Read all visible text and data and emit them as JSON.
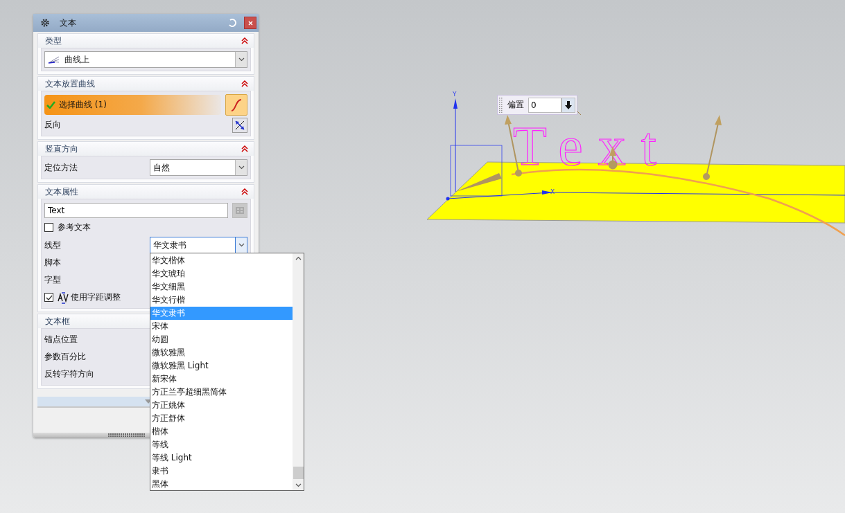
{
  "dialog": {
    "title": "文本",
    "sections": [
      {
        "title": "类型",
        "expanded": true,
        "rows": [
          {
            "kind": "type-select",
            "value": "曲线上"
          }
        ]
      },
      {
        "title": "文本放置曲线",
        "expanded": true,
        "rows": [
          {
            "kind": "selection",
            "label": "选择曲线 (1)",
            "done": true
          },
          {
            "kind": "reverse",
            "label": "反向"
          }
        ]
      },
      {
        "title": "竖直方向",
        "expanded": true,
        "rows": [
          {
            "kind": "select",
            "label": "定位方法",
            "value": "自然",
            "open": false
          }
        ]
      },
      {
        "title": "文本属性",
        "expanded": true,
        "rows": [
          {
            "kind": "text-input",
            "value": "Text"
          },
          {
            "kind": "checkbox",
            "label": "参考文本",
            "checked": false
          },
          {
            "kind": "select",
            "label": "线型",
            "value": "华文隶书",
            "open": true
          },
          {
            "kind": "label",
            "label": "脚本"
          },
          {
            "kind": "label",
            "label": "字型"
          },
          {
            "kind": "kerning-checkbox",
            "label": "使用字距调整",
            "checked": true
          }
        ]
      },
      {
        "title": "文本框",
        "rows": [
          {
            "kind": "label",
            "label": "锚点位置"
          },
          {
            "kind": "label",
            "label": "参数百分比"
          },
          {
            "kind": "label",
            "label": "反转字符方向"
          }
        ]
      }
    ]
  },
  "font_list": {
    "items": [
      {
        "label": "华文楷体",
        "selected": false
      },
      {
        "label": "华文琥珀",
        "selected": false
      },
      {
        "label": "华文细黑",
        "selected": false
      },
      {
        "label": "华文行楷",
        "selected": false
      },
      {
        "label": "华文隶书",
        "selected": true
      },
      {
        "label": "宋体",
        "selected": false
      },
      {
        "label": "幼圆",
        "selected": false
      },
      {
        "label": "微软雅黑",
        "selected": false
      },
      {
        "label": "微软雅黑 Light",
        "selected": false
      },
      {
        "label": "新宋体",
        "selected": false
      },
      {
        "label": "方正兰亭超细黑简体",
        "selected": false
      },
      {
        "label": "方正姚体",
        "selected": false
      },
      {
        "label": "方正舒体",
        "selected": false
      },
      {
        "label": "楷体",
        "selected": false
      },
      {
        "label": "等线",
        "selected": false
      },
      {
        "label": "等线 Light",
        "selected": false
      },
      {
        "label": "隶书",
        "selected": false
      },
      {
        "label": "黑体",
        "selected": false
      }
    ]
  },
  "scene": {
    "text": "Text",
    "axis_y": "Y",
    "axis_x": "X",
    "offset": {
      "label": "偏置",
      "value": "0"
    }
  }
}
